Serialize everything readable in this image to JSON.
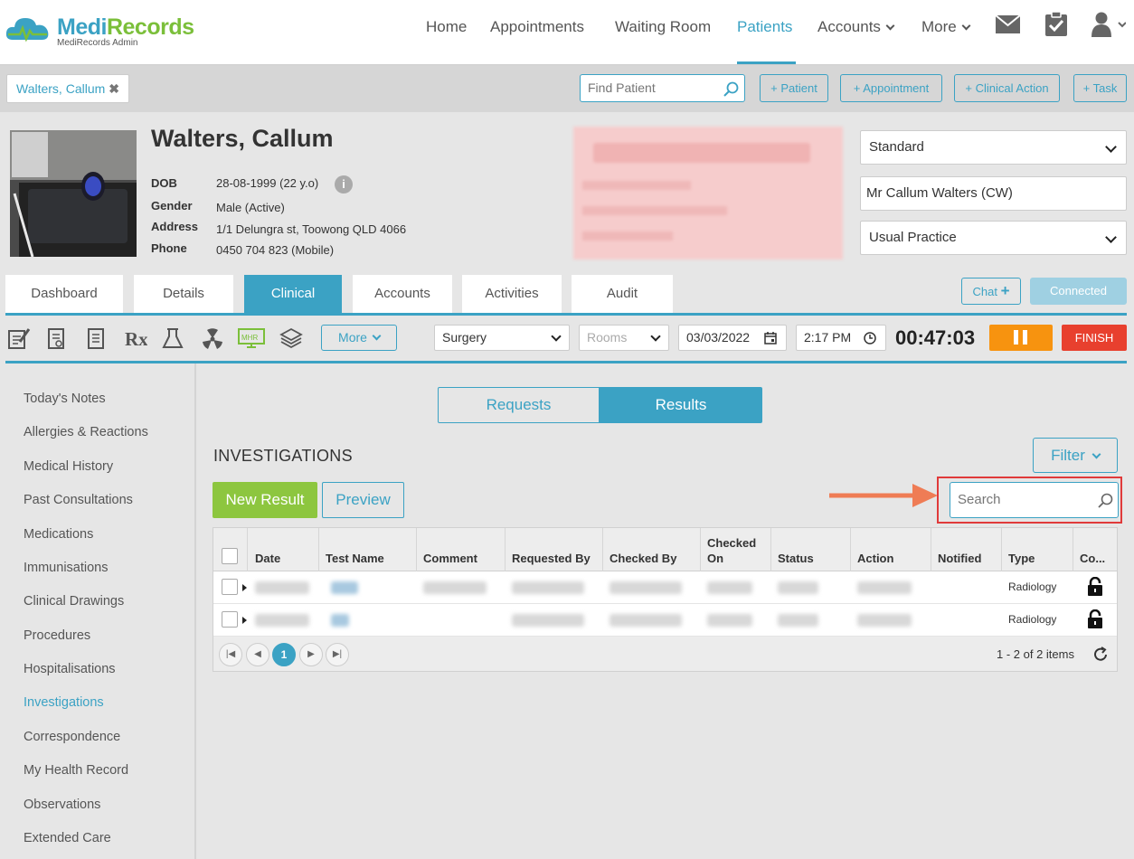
{
  "app": {
    "brand_part1": "Medi",
    "brand_part2": "Records",
    "subtitle": "MediRecords Admin"
  },
  "nav": {
    "items": [
      {
        "label": "Home",
        "active": false
      },
      {
        "label": "Appointments",
        "active": false
      },
      {
        "label": "Waiting Room",
        "active": false
      },
      {
        "label": "Patients",
        "active": true
      },
      {
        "label": "Accounts",
        "dropdown": true
      },
      {
        "label": "More",
        "dropdown": true
      }
    ],
    "icons": [
      "mail-icon",
      "clipboard-check-icon",
      "user-icon"
    ]
  },
  "patient_bar": {
    "open_tab": "Walters, Callum",
    "find_placeholder": "Find Patient",
    "actions": [
      "+ Patient",
      "+ Appointment",
      "+ Clinical Action",
      "+ Task"
    ]
  },
  "patient": {
    "name": "Walters, Callum",
    "dob_label": "DOB",
    "dob": "28-08-1999 (22 y.o)",
    "gender_label": "Gender",
    "gender": "Male (Active)",
    "address_label": "Address",
    "address": "1/1 Delungra st, Toowong QLD 4066",
    "phone_label": "Phone",
    "phone": "0450 704 823 (Mobile)",
    "info_glyph": "i"
  },
  "right_panel": {
    "template": "Standard",
    "display_name": "Mr Callum Walters (CW)",
    "practice": "Usual Practice"
  },
  "tabs": [
    {
      "label": "Dashboard",
      "active": false
    },
    {
      "label": "Details",
      "active": false
    },
    {
      "label": "Clinical",
      "active": true
    },
    {
      "label": "Accounts",
      "active": false
    },
    {
      "label": "Activities",
      "active": false
    },
    {
      "label": "Audit",
      "active": false
    }
  ],
  "chat": {
    "label": "Chat",
    "plus": "+",
    "status": "Connected"
  },
  "toolbar": {
    "icons": [
      "notes-icon",
      "prescription-pad-icon",
      "document-list-icon",
      "rx-icon",
      "pathology-flask-icon",
      "radiology-icon",
      "mhr-icon",
      "stack-icon"
    ],
    "mhr_text": "MHR",
    "more_label": "More",
    "surgery": "Surgery",
    "rooms_placeholder": "Rooms",
    "date": "03/03/2022",
    "time": "2:17 PM",
    "timer": "00:47:03",
    "finish_label": "FINISH"
  },
  "sidebar": [
    {
      "label": "Today's Notes",
      "active": false
    },
    {
      "label": "Allergies & Reactions",
      "active": false
    },
    {
      "label": "Medical History",
      "active": false
    },
    {
      "label": "Past Consultations",
      "active": false
    },
    {
      "label": "Medications",
      "active": false
    },
    {
      "label": "Immunisations",
      "active": false
    },
    {
      "label": "Clinical Drawings",
      "active": false
    },
    {
      "label": "Procedures",
      "active": false
    },
    {
      "label": "Hospitalisations",
      "active": false
    },
    {
      "label": "Investigations",
      "active": true
    },
    {
      "label": "Correspondence",
      "active": false
    },
    {
      "label": "My Health Record",
      "active": false
    },
    {
      "label": "Observations",
      "active": false
    },
    {
      "label": "Extended Care",
      "active": false
    }
  ],
  "investigations": {
    "segments": {
      "requests": "Requests",
      "results": "Results",
      "selected": "Results"
    },
    "title": "INVESTIGATIONS",
    "filter_label": "Filter",
    "new_result_label": "New Result",
    "preview_label": "Preview",
    "search_placeholder": "Search",
    "columns": [
      "Date",
      "Test Name",
      "Comment",
      "Requested By",
      "Checked By",
      "Checked On",
      "Status",
      "Action",
      "Notified",
      "Type",
      "Co..."
    ],
    "rows": [
      {
        "type": "Radiology",
        "locked": false
      },
      {
        "type": "Radiology",
        "locked": false
      }
    ],
    "pagination": {
      "current_page": "1",
      "summary": "1 - 2 of 2 items"
    }
  },
  "colors": {
    "accent": "#3ba2c4",
    "brand_green": "#7bbf3a",
    "new_result_green": "#8dc63f",
    "pause_orange": "#f7930f",
    "finish_red": "#e8402e",
    "highlight_red": "#e03a3a",
    "arrow_orange": "#ef7c55"
  }
}
